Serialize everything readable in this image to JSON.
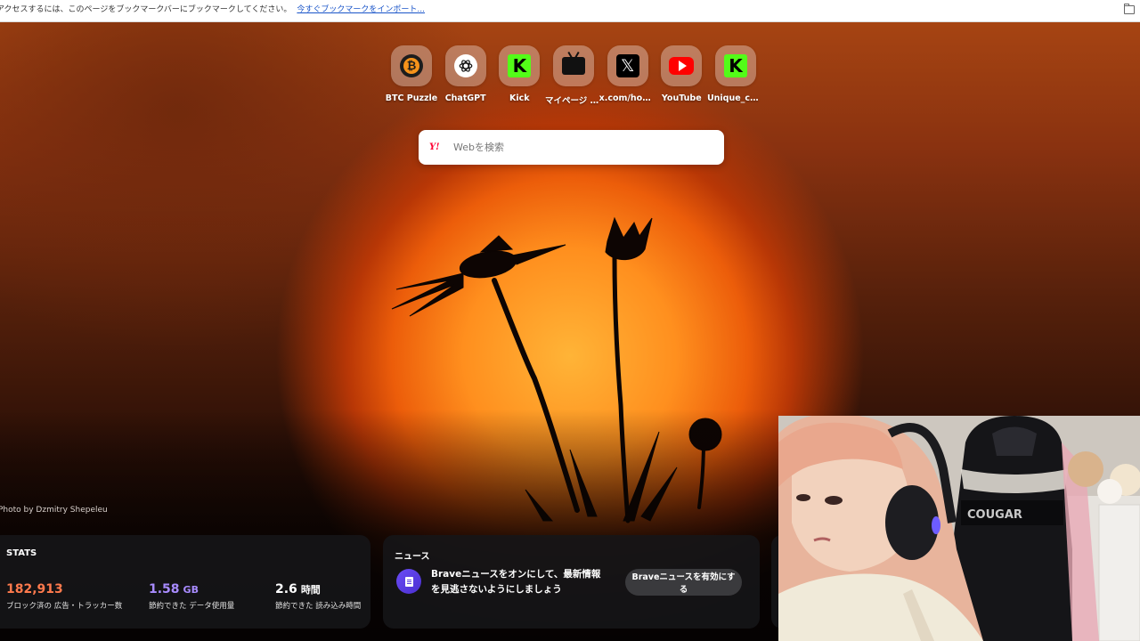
{
  "bookmark_bar": {
    "message": "アクセスするには、このページをブックマークバーにブックマークしてください。",
    "import_link": "今すぐブックマークをインポート..."
  },
  "top_sites": [
    {
      "label": "BTC Puzzle",
      "icon": "btc-icon"
    },
    {
      "label": "ChatGPT",
      "icon": "chatgpt-icon"
    },
    {
      "label": "Kick",
      "icon": "kick-icon"
    },
    {
      "label": "マイページ 最...",
      "icon": "tv-icon"
    },
    {
      "label": "x.com/home",
      "icon": "x-icon"
    },
    {
      "label": "YouTube",
      "icon": "youtube-icon"
    },
    {
      "label": "Unique_cat...",
      "icon": "kick-icon"
    }
  ],
  "search": {
    "engine_icon": "Y!",
    "placeholder": "Webを検索"
  },
  "photo_credit": "Photo by Dzmitry Shepeleu",
  "stats": {
    "title": "STATS",
    "items": [
      {
        "value": "182,913",
        "unit": "",
        "desc": "ブロック済の 広告・トラッカー数",
        "color": "#ff7a4d"
      },
      {
        "value": "1.58",
        "unit": "GB",
        "desc": "節約できた データ使用量",
        "color": "#a88bff"
      },
      {
        "value": "2.6",
        "unit": "時間",
        "desc": "節約できた 読み込み時間",
        "color": "#ffffff"
      }
    ]
  },
  "news": {
    "title": "ニュース",
    "message": "Braveニュースをオンにして、最新情報を見逃さないようにしましょう",
    "button": "Braveニュースを有効にする"
  }
}
